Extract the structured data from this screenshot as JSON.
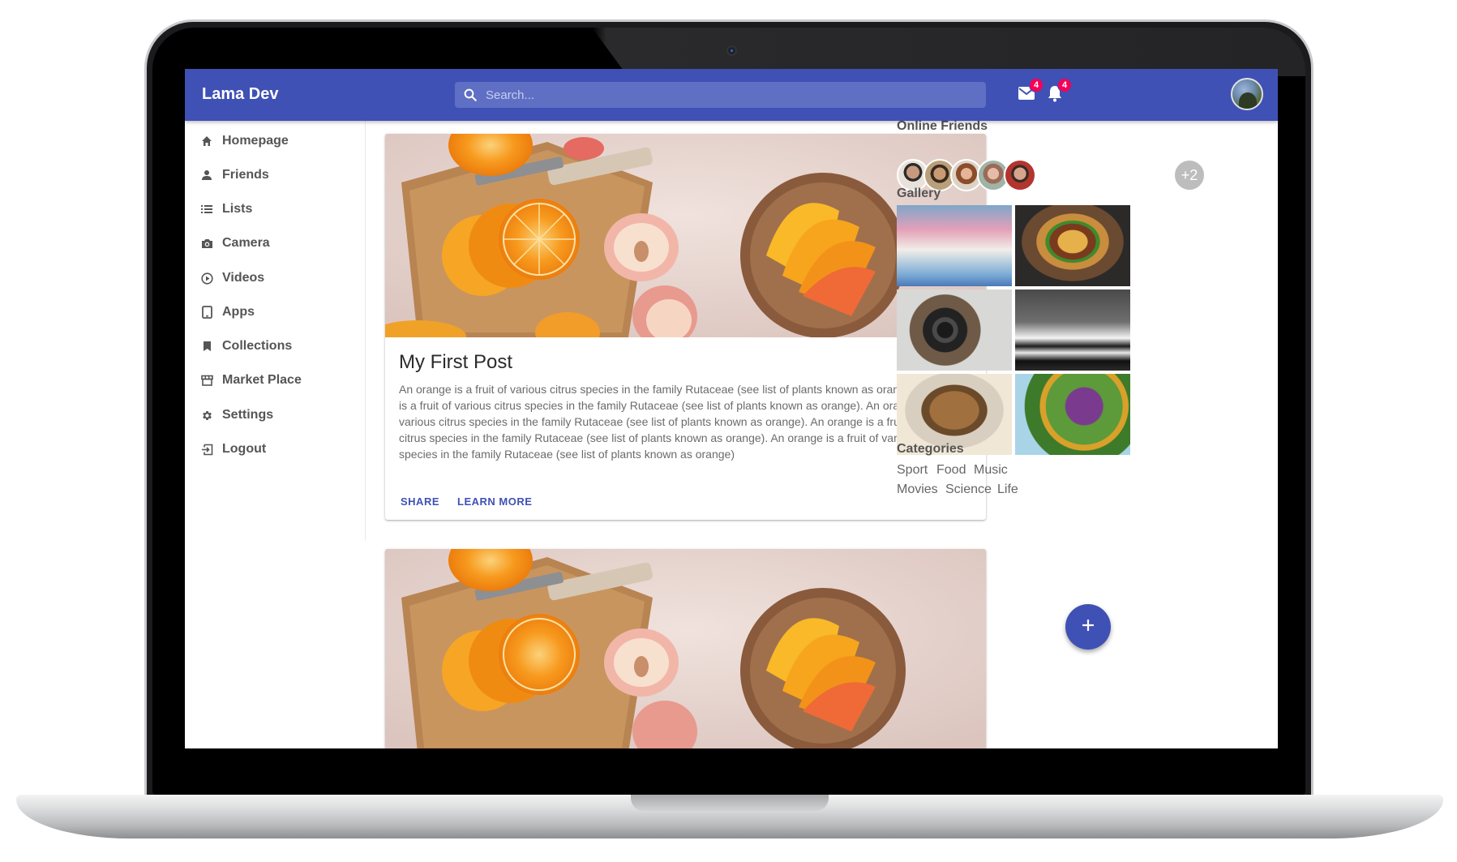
{
  "appbar": {
    "brand": "Lama Dev",
    "search_placeholder": "Search...",
    "mail_badge": "4",
    "notifications_badge": "4"
  },
  "sidebar": {
    "items": [
      {
        "label": "Homepage",
        "icon": "home-icon"
      },
      {
        "label": "Friends",
        "icon": "person-icon"
      },
      {
        "label": "Lists",
        "icon": "list-icon"
      },
      {
        "label": "Camera",
        "icon": "camera-icon"
      },
      {
        "label": "Videos",
        "icon": "play-circle-icon"
      },
      {
        "label": "Apps",
        "icon": "tablet-icon"
      },
      {
        "label": "Collections",
        "icon": "bookmark-icon"
      },
      {
        "label": "Market Place",
        "icon": "storefront-icon"
      },
      {
        "label": "Settings",
        "icon": "gear-icon"
      },
      {
        "label": "Logout",
        "icon": "exit-icon"
      }
    ]
  },
  "feed": {
    "posts": [
      {
        "title": "My First Post",
        "text": "An orange is a fruit of various citrus species in the family Rutaceae (see list of plants known as orange). An orange is a fruit of various citrus species in the family Rutaceae (see list of plants known as orange). An orange is a fruit of various citrus species in the family Rutaceae (see list of plants known as orange). An orange is a fruit of various citrus species in the family Rutaceae (see list of plants known as orange). An orange is a fruit of various citrus species in the family Rutaceae (see list of plants known as orange)",
        "share_label": "SHARE",
        "learn_more_label": "LEARN MORE"
      }
    ]
  },
  "rightbar": {
    "online_friends_title": "Online Friends",
    "more_friends": "+2",
    "gallery_title": "Gallery",
    "categories_title": "Categories",
    "categories": [
      "Sport",
      "Food",
      "Music",
      "Movies",
      "Science",
      "Life"
    ]
  },
  "colors": {
    "primary": "#3f51b5",
    "badge": "#f50057"
  }
}
